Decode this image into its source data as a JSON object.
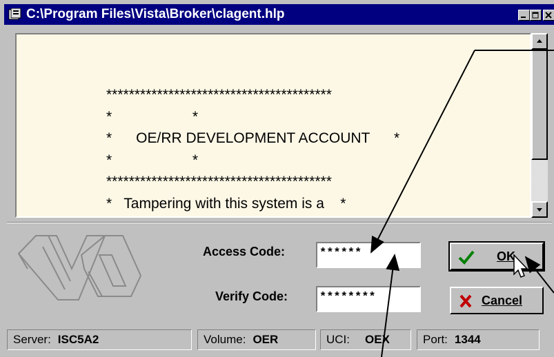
{
  "window": {
    "title": "C:\\Program Files\\Vista\\Broker\\clagent.hlp",
    "title_icon": "help-file-icon"
  },
  "titlebar_buttons": [
    "minimize-icon",
    "maximize-icon",
    "close-icon"
  ],
  "help_text": "****************************************\n*                    *\n*      OE/RR DEVELOPMENT ACCOUNT      *\n*                    *\n****************************************\n*   Tampering with this system is a    *",
  "logo": "va-logo",
  "login": {
    "access_label": "Access Code:",
    "access_value": "******",
    "verify_label": "Verify Code:",
    "verify_value": "********"
  },
  "buttons": {
    "ok_label": "OK",
    "ok_icon": "checkmark-icon",
    "cancel_label": "Cancel",
    "cancel_icon": "x-icon"
  },
  "status": {
    "server_label": "Server:",
    "server_value": "ISC5A2",
    "volume_label": "Volume:",
    "volume_value": "OER",
    "uci_label": "UCI:",
    "uci_value": "OEX",
    "port_label": "Port:",
    "port_value": "1344"
  },
  "colors": {
    "titlebar": "#000080",
    "text_pane": "#fdf8e6",
    "window_face": "#c0c0c0",
    "ok_check": "#008000",
    "cancel_x": "#c00000"
  }
}
